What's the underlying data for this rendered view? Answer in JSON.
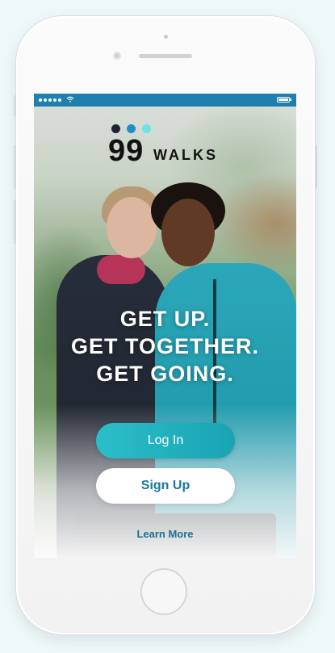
{
  "status_bar": {
    "signal_icon": "signal-dots-icon",
    "wifi_icon": "wifi-icon",
    "battery_icon": "battery-icon",
    "color": "#1f7fae"
  },
  "logo": {
    "number": "99",
    "word": "WALKS",
    "dot_colors": [
      "#1d2333",
      "#1f8fc3",
      "#6fe1e8"
    ]
  },
  "hero": {
    "line1": "GET UP.",
    "line2": "GET TOGETHER.",
    "line3": "GET GOING."
  },
  "actions": {
    "login_label": "Log In",
    "signup_label": "Sign Up",
    "learn_more_label": "Learn More"
  },
  "colors": {
    "accent": "#22b3c1",
    "link": "#1d6f93",
    "background": "#eef8f9"
  }
}
